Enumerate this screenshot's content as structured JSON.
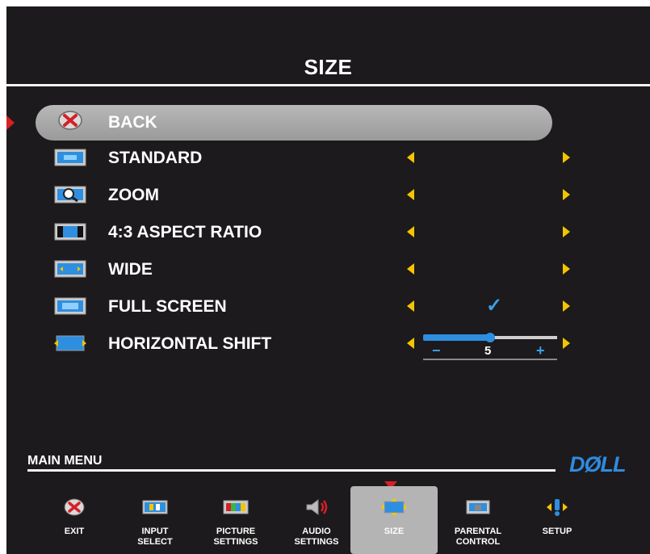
{
  "header": {
    "title": "SIZE"
  },
  "menu": {
    "back": {
      "label": "BACK",
      "icon": "back-icon"
    },
    "items": [
      {
        "label": "STANDARD",
        "icon": "standard-icon"
      },
      {
        "label": "ZOOM",
        "icon": "zoom-icon"
      },
      {
        "label": "4:3 ASPECT RATIO",
        "icon": "aspect-ratio-icon"
      },
      {
        "label": "WIDE",
        "icon": "wide-icon"
      },
      {
        "label": "FULL SCREEN",
        "icon": "full-screen-icon",
        "selected": true
      },
      {
        "label": "HORIZONTAL SHIFT",
        "icon": "horizontal-shift-icon"
      }
    ],
    "horizontal_shift": {
      "value": "5",
      "minus": "−",
      "plus": "+",
      "level": 0.5
    },
    "checkmark": "✓"
  },
  "footer": {
    "main_menu_label": "MAIN MENU",
    "brand": "DØLL",
    "nav": [
      {
        "line1": "EXIT",
        "line2": "",
        "icon": "exit-icon"
      },
      {
        "line1": "INPUT",
        "line2": "SELECT",
        "icon": "input-select-icon"
      },
      {
        "line1": "PICTURE",
        "line2": "SETTINGS",
        "icon": "picture-settings-icon"
      },
      {
        "line1": "AUDIO",
        "line2": "SETTINGS",
        "icon": "audio-settings-icon"
      },
      {
        "line1": "SIZE",
        "line2": "",
        "icon": "size-icon",
        "active": true
      },
      {
        "line1": "PARENTAL",
        "line2": "CONTROL",
        "icon": "parental-control-icon"
      },
      {
        "line1": "SETUP",
        "line2": "",
        "icon": "setup-icon"
      }
    ]
  },
  "colors": {
    "background": "#1c1a1c",
    "accent": "#2e8fe0",
    "arrow": "#f5c400",
    "marker": "#d61f26"
  }
}
